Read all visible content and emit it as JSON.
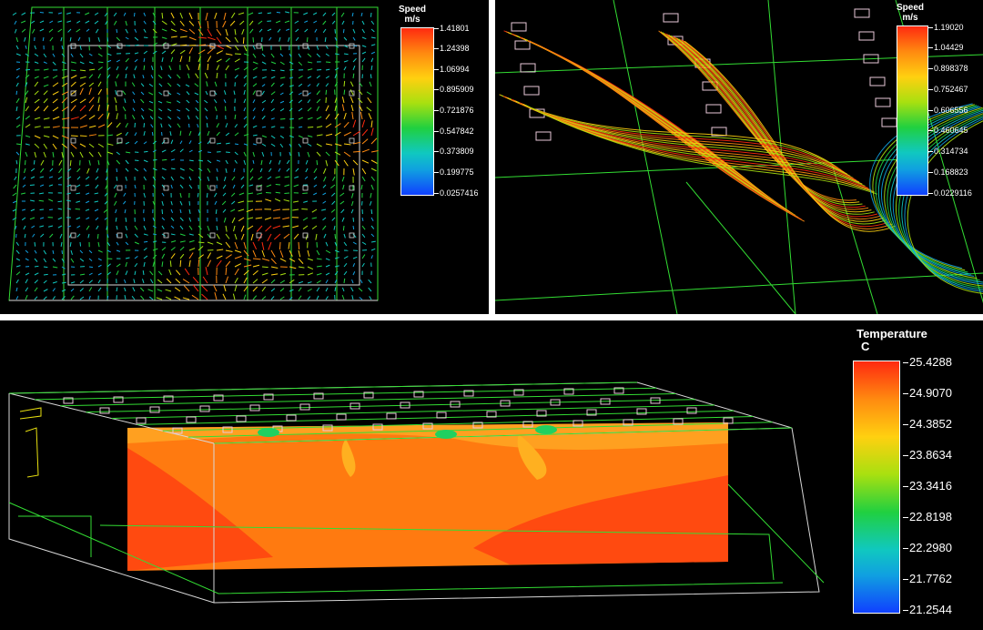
{
  "panels": {
    "top_left": {
      "legend_title": "Speed",
      "legend_unit": "m/s",
      "ticks": [
        "1.41801",
        "1.24398",
        "1.06994",
        "0.895909",
        "0.721876",
        "0.547842",
        "0.373809",
        "0.199775",
        "0.0257416"
      ]
    },
    "top_right": {
      "legend_title": "Speed",
      "legend_unit": "m/s",
      "ticks": [
        "1.19020",
        "1.04429",
        "0.898378",
        "0.752467",
        "0.606556",
        "0.460645",
        "0.314734",
        "0.168823",
        "0.0229116"
      ]
    },
    "bottom": {
      "legend_title": "Temperature",
      "legend_unit": "C",
      "ticks": [
        "25.4288",
        "24.9070",
        "24.3852",
        "23.8634",
        "23.3416",
        "22.8198",
        "22.2980",
        "21.7762",
        "21.2544"
      ]
    }
  },
  "colors": {
    "background": "#000000",
    "wireframe": "#33dd33",
    "outline": "#d8d8d8",
    "diffuser": "#e8c8d8",
    "scale": [
      "#ff2a10",
      "#ff8a10",
      "#ffd010",
      "#a8e010",
      "#20d040",
      "#10c8c0",
      "#10a0e0",
      "#1040ff"
    ]
  }
}
